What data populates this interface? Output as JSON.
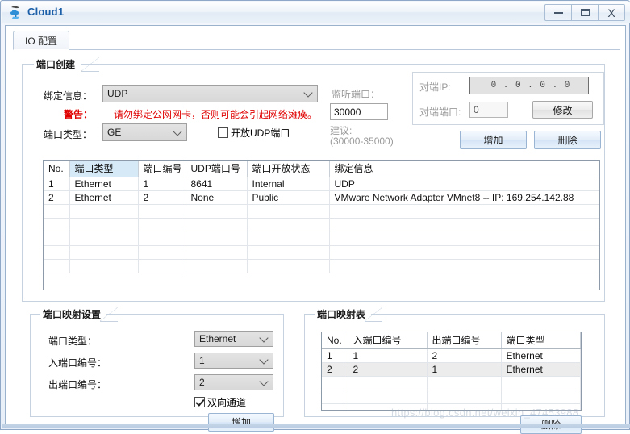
{
  "window": {
    "title": "Cloud1",
    "icon": "cloud-icon",
    "minimize_label": "—",
    "maximize_label": "□",
    "close_label": "X",
    "accent_color": "#1b5fa8"
  },
  "tabs": [
    {
      "label": "IO 配置",
      "active": true
    }
  ],
  "port_create": {
    "caption": "端口创建",
    "binding_label": "绑定信息：",
    "binding_value": "UDP",
    "warning_label": "警告：",
    "warning_text": "请勿绑定公网网卡，否则可能会引起网络瘫痪。",
    "warning_color": "#e00000",
    "port_type_label": "端口类型：",
    "port_type_value": "GE",
    "open_udp_label": "开放UDP端口",
    "open_udp_checked": false,
    "listen_port_label": "监听端口：",
    "listen_port_value": "30000",
    "suggest_label": "建议:",
    "suggest_range": "(30000-35000)",
    "peer_ip_label": "对端IP:",
    "peer_ip_value": "0 . 0 . 0 . 0",
    "peer_port_label": "对端端口:",
    "peer_port_value": "0",
    "modify_label": "修改",
    "add_label": "增加",
    "delete_label": "删除"
  },
  "port_table": {
    "columns": [
      "No.",
      "端口类型",
      "端口编号",
      "UDP端口号",
      "端口开放状态",
      "绑定信息"
    ],
    "highlight_column_index": 1,
    "rows": [
      [
        "1",
        "Ethernet",
        "1",
        "8641",
        "Internal",
        "UDP"
      ],
      [
        "2",
        "Ethernet",
        "2",
        "None",
        "Public",
        "VMware Network Adapter VMnet8 -- IP: 169.254.142.88"
      ]
    ],
    "empty_rows": 5
  },
  "mapping_settings": {
    "caption": "端口映射设置",
    "port_type_label": "端口类型：",
    "port_type_value": "Ethernet",
    "in_port_label": "入端口编号：",
    "in_port_value": "1",
    "out_port_label": "出端口编号：",
    "out_port_value": "2",
    "bidirectional_label": "双向通道",
    "bidirectional_checked": true,
    "add_label": "增加"
  },
  "mapping_table": {
    "caption": "端口映射表",
    "columns": [
      "No.",
      "入端口编号",
      "出端口编号",
      "端口类型"
    ],
    "rows": [
      {
        "cells": [
          "1",
          "1",
          "2",
          "Ethernet"
        ],
        "selected": false
      },
      {
        "cells": [
          "2",
          "2",
          "1",
          "Ethernet"
        ],
        "selected": true
      }
    ],
    "empty_rows": 3,
    "delete_label": "删除"
  },
  "watermark": {
    "text": "https://blog.csdn.net/weixin_47453988"
  }
}
